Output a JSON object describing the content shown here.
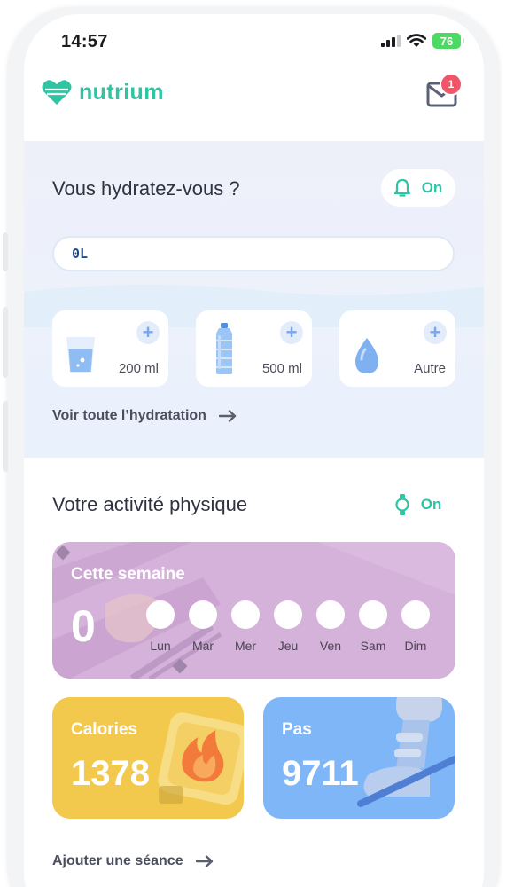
{
  "status_bar": {
    "time": "14:57",
    "battery": "76"
  },
  "header": {
    "brand": "nutrium",
    "notification_count": "1"
  },
  "hydration": {
    "title": "Vous hydratez-vous ?",
    "reminder_state": "On",
    "amount": "0L",
    "drinks": [
      {
        "label": "200 ml",
        "icon": "glass-icon"
      },
      {
        "label": "500 ml",
        "icon": "bottle-icon"
      },
      {
        "label": "Autre",
        "icon": "drop-icon"
      }
    ],
    "add_symbol": "+",
    "see_all_label": "Voir toute l’hydratation"
  },
  "activity": {
    "title": "Votre activité physique",
    "tracker_state": "On",
    "week": {
      "title": "Cette semaine",
      "count": "0",
      "days": [
        "Lun",
        "Mar",
        "Mer",
        "Jeu",
        "Ven",
        "Sam",
        "Dim"
      ]
    },
    "calories": {
      "label": "Calories",
      "value": "1378"
    },
    "steps": {
      "label": "Pas",
      "value": "9711"
    },
    "add_session_label": "Ajouter une séance"
  },
  "colors": {
    "brand": "#2ec4a4",
    "activity_card": "#d4b2d9",
    "calories_card": "#f2c94c",
    "steps_card": "#7fb6f7",
    "badge": "#f05668"
  }
}
